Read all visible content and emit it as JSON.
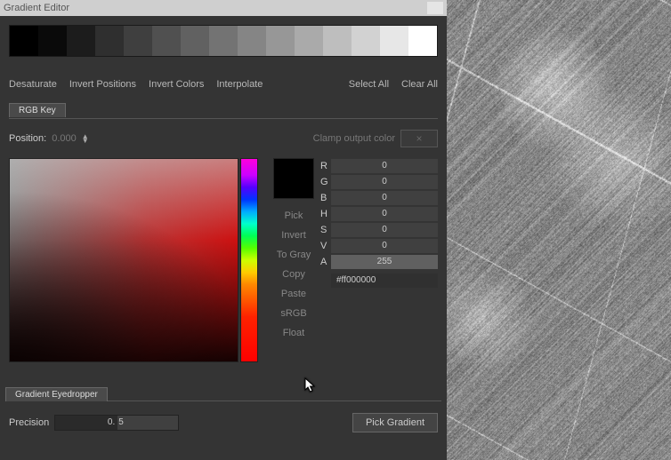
{
  "title": "Gradient Editor",
  "gradient_stops": [
    "#000000",
    "#0a0a0a",
    "#1c1c1c",
    "#2f2f2f",
    "#3f3f3f",
    "#505050",
    "#616161",
    "#737373",
    "#858585",
    "#979797",
    "#aaaaaa",
    "#bebebe",
    "#d2d2d2",
    "#e7e7e7",
    "#ffffff"
  ],
  "actions": {
    "desaturate": "Desaturate",
    "invert_positions": "Invert Positions",
    "invert_colors": "Invert Colors",
    "interpolate": "Interpolate",
    "select_all": "Select All",
    "clear_all": "Clear All"
  },
  "tab": "RGB Key",
  "position_label": "Position:",
  "position_value": "0.000",
  "clamp_label": "Clamp output color",
  "clamp_icon": "×",
  "side_buttons": {
    "pick": "Pick",
    "invert": "Invert",
    "to_gray": "To Gray",
    "copy": "Copy",
    "paste": "Paste",
    "srgb": "sRGB",
    "float": "Float"
  },
  "fields": {
    "R": "0",
    "G": "0",
    "B": "0",
    "H": "0",
    "S": "0",
    "V": "0",
    "A": "255"
  },
  "hex": "#ff000000",
  "preview_color": "#000000",
  "bottom_tab": "Gradient Eyedropper",
  "precision_label": "Precision",
  "precision_left": "0.",
  "precision_right": "5",
  "pick_gradient": "Pick Gradient"
}
